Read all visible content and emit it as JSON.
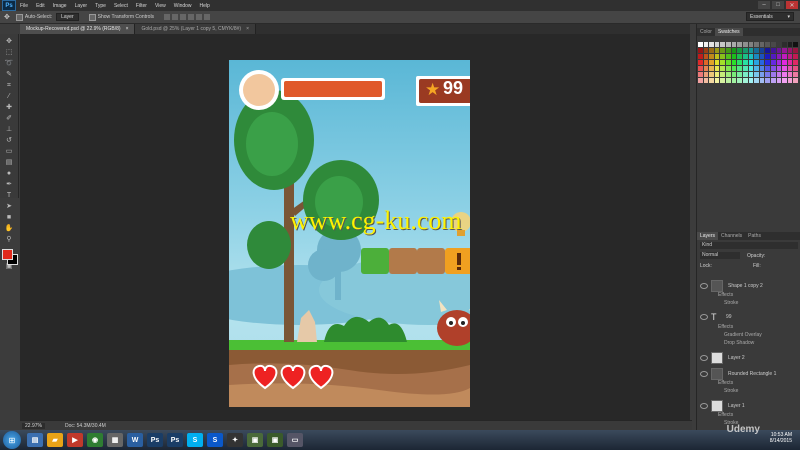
{
  "menu": {
    "app_icon": "Ps",
    "items": [
      "File",
      "Edit",
      "Image",
      "Layer",
      "Type",
      "Select",
      "Filter",
      "View",
      "Window",
      "Help"
    ]
  },
  "window_controls": {
    "minimize": "–",
    "maximize": "□",
    "close": "✕"
  },
  "options": {
    "auto_select_label": "Auto-Select:",
    "auto_select_value": "Layer",
    "transform_label": "Show Transform Controls",
    "workspace": "Essentials"
  },
  "tabs": [
    {
      "label": "Mockup-Recovered.psd @ 22.9% (RGB/8)",
      "close": "×"
    },
    {
      "label": "Gold.psd @ 25% (Layer 1 copy 5, CMYK/8#)",
      "close": "×"
    }
  ],
  "status": {
    "zoom": "22.97%",
    "doc": "Doc: 54.3M/30.4M"
  },
  "panels": {
    "color_tabs": [
      "Color",
      "Swatches"
    ],
    "layer_tabs": [
      "Layers",
      "Channels",
      "Paths"
    ],
    "kind": "Kind",
    "blend": "Normal",
    "opacity_label": "Opacity:",
    "lock_label": "Lock:",
    "fill_label": "Fill:"
  },
  "layers": [
    {
      "name": "Shape 1 copy 2",
      "fx": [
        "Effects",
        "Stroke"
      ]
    },
    {
      "name": "99",
      "fx": [
        "Effects",
        "Gradient Overlay",
        "Drop Shadow"
      ]
    },
    {
      "name": "Layer 2",
      "fx": []
    },
    {
      "name": "Rounded Rectangle 1",
      "fx": [
        "Effects",
        "Stroke"
      ]
    },
    {
      "name": "Layer 1",
      "fx": [
        "Effects",
        "Stroke"
      ]
    }
  ],
  "game": {
    "score": "99",
    "star": "★"
  },
  "watermark": "www.cg-ku.com",
  "udemy": "Udemy",
  "taskbar": {
    "start": "⊞",
    "clock_time": "10:53 AM",
    "clock_date": "8/14/2015"
  },
  "colors": {
    "fg": "#e0291b",
    "bg": "#000000",
    "accent": "#1e90ff"
  }
}
